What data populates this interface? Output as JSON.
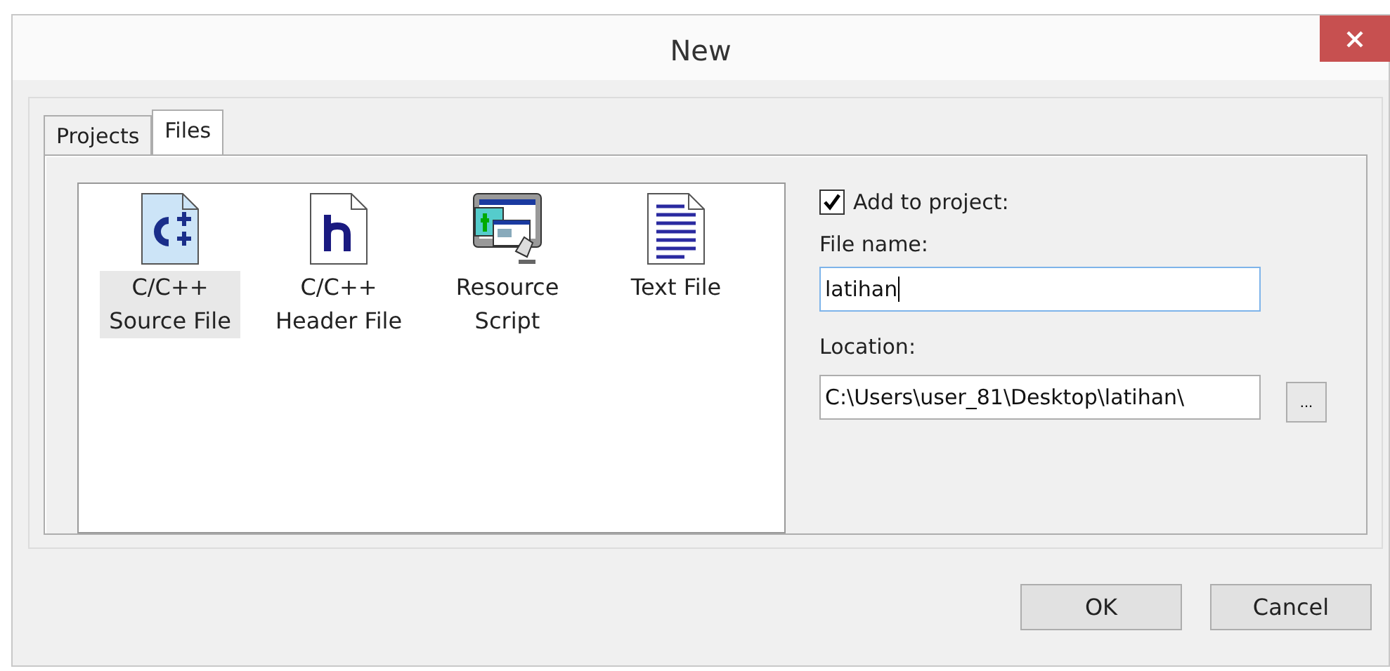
{
  "window": {
    "title": "New"
  },
  "tabs": [
    {
      "label": "Projects",
      "selected": false
    },
    {
      "label": "Files",
      "selected": true
    }
  ],
  "file_types": [
    {
      "kind": "cpp",
      "label": "C/C++ Source File",
      "selected": true
    },
    {
      "kind": "h",
      "label": "C/C++ Header File",
      "selected": false
    },
    {
      "kind": "rc",
      "label": "Resource Script",
      "selected": false
    },
    {
      "kind": "txt",
      "label": "Text File",
      "selected": false
    }
  ],
  "add_to_project": {
    "label": "Add to project:",
    "checked": true
  },
  "file_name": {
    "label": "File name:",
    "value": "latihan"
  },
  "location": {
    "label": "Location:",
    "value": "C:\\Users\\user_81\\Desktop\\latihan\\",
    "browse": "..."
  },
  "buttons": [
    "OK",
    "Cancel"
  ]
}
